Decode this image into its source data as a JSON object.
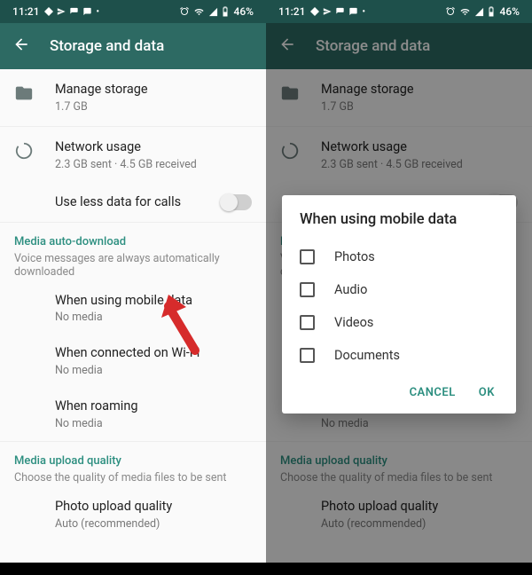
{
  "status": {
    "time": "11:21",
    "battery": "46%"
  },
  "appbar": {
    "title": "Storage and data"
  },
  "manage_storage": {
    "title": "Manage storage",
    "sub": "1.7 GB"
  },
  "network_usage": {
    "title": "Network usage",
    "sub": "2.3 GB sent · 4.5 GB received"
  },
  "use_less_data": {
    "title": "Use less data for calls"
  },
  "media_section": {
    "title": "Media auto-download",
    "sub": "Voice messages are always automatically downloaded"
  },
  "mobile_data": {
    "title": "When using mobile data",
    "sub": "No media"
  },
  "wifi": {
    "title": "When connected on Wi-Fi",
    "sub": "No media"
  },
  "roaming": {
    "title": "When roaming",
    "sub": "No media"
  },
  "upload_section": {
    "title": "Media upload quality",
    "sub": "Choose the quality of media files to be sent"
  },
  "photo_quality": {
    "title": "Photo upload quality",
    "sub": "Auto (recommended)"
  },
  "dialog": {
    "title": "When using mobile data",
    "opt1": "Photos",
    "opt2": "Audio",
    "opt3": "Videos",
    "opt4": "Documents",
    "cancel": "CANCEL",
    "ok": "OK"
  }
}
